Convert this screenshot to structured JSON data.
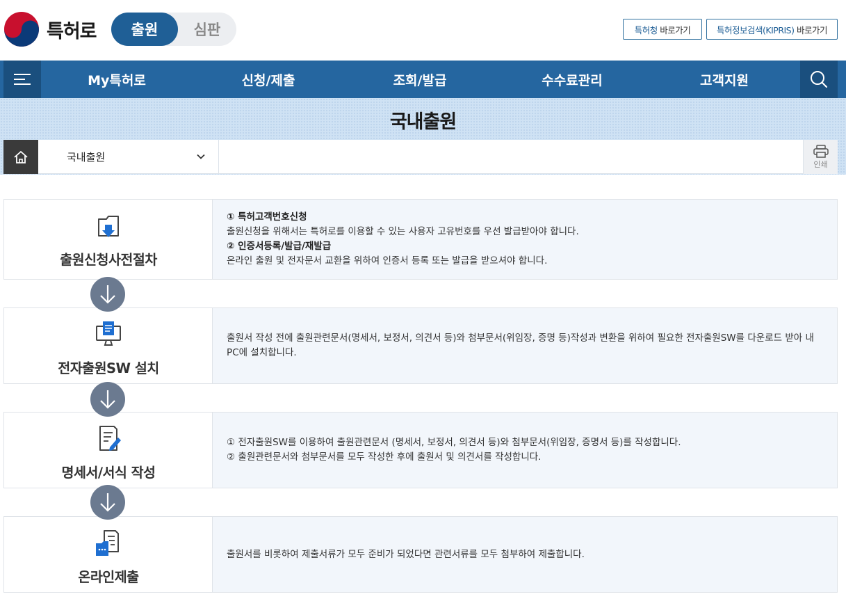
{
  "header": {
    "logo_text": "특허로",
    "toggle": {
      "active": "출원",
      "inactive": "심판"
    },
    "links": [
      {
        "highlight": "특허청",
        "rest": " 바로가기"
      },
      {
        "highlight": "특허정보검색(KIPRIS)",
        "rest": " 바로가기"
      }
    ]
  },
  "nav": {
    "items": [
      "My특허로",
      "신청/제출",
      "조회/발급",
      "수수료관리",
      "고객지원"
    ]
  },
  "page": {
    "title": "국내출원",
    "breadcrumb": {
      "selected": "국내출원"
    },
    "print_label": "인쇄"
  },
  "steps": [
    {
      "title": "출원신청사전절차",
      "icon": "folder-download-icon",
      "lines": [
        {
          "text": "① 특허고객번호신청",
          "bold": true
        },
        {
          "text": "출원신청을 위해서는 특허로를 이용할 수 있는 사용자 고유번호를 우선 발급받아야 합니다.",
          "bold": false
        },
        {
          "text": "② 인증서등록/발급/재발급",
          "bold": true
        },
        {
          "text": "온라인 출원 및 전자문서 교환을 위하여 인증서 등록 또는 발급을 받으셔야 합니다.",
          "bold": false
        }
      ]
    },
    {
      "title": "전자출원SW 설치",
      "icon": "monitor-document-icon",
      "lines": [
        {
          "text": "출원서 작성 전에 출원관련문서(명세서, 보정서, 의견서 등)와 첨부문서(위임장, 증명 등)작성과 변환을 위하여 필요한 전자출원SW를 다운로드 받아 내 PC에 설치합니다.",
          "bold": false
        }
      ]
    },
    {
      "title": "명세서/서식 작성",
      "icon": "document-edit-icon",
      "lines": [
        {
          "text": "① 전자출원SW를 이용하여 출원관련문서 (명세서, 보정서, 의견서 등)와 첨부문서(위임장, 증명서 등)를 작성합니다.",
          "bold": false
        },
        {
          "text": "② 출원관련문서와 첨부문서를 모두 작성한 후에 출원서 및 의견서를 작성합니다.",
          "bold": false
        }
      ]
    },
    {
      "title": "온라인제출",
      "icon": "folder-submit-icon",
      "lines": [
        {
          "text": "출원서를 비롯하여 제출서류가 모두 준비가 되었다면 관련서류를 모두 첨부하여 제출합니다.",
          "bold": false
        }
      ]
    }
  ],
  "colors": {
    "nav": "#2566a0",
    "nav_dark": "#1a4f7e",
    "toggle_active": "#1f5f96",
    "arrow": "#6b7a90",
    "step_bg": "#f2f6fb"
  }
}
